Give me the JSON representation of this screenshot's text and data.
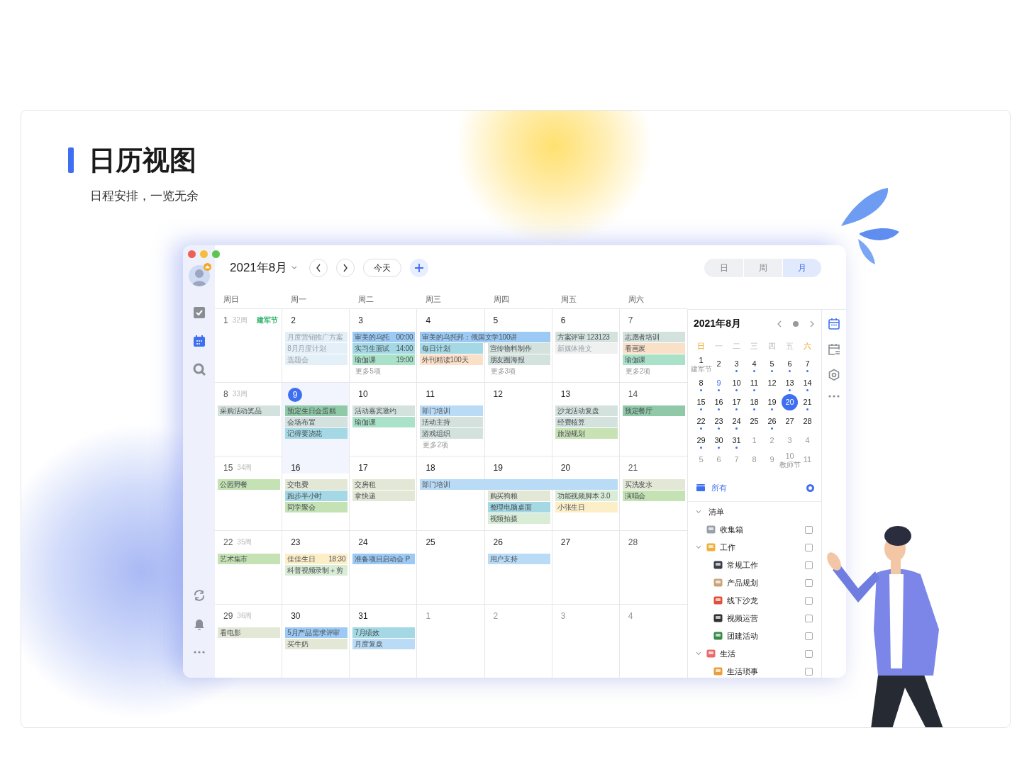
{
  "page": {
    "title": "日历视图",
    "subtitle": "日程安排，一览无余"
  },
  "nav": [
    {
      "kind": "tasks",
      "selected": false
    },
    {
      "kind": "calendar",
      "selected": true
    },
    {
      "kind": "search",
      "selected": false
    }
  ],
  "header": {
    "month": "2021年8月",
    "today_button": "今天",
    "views": [
      {
        "label": "日",
        "selected": false
      },
      {
        "label": "周",
        "selected": false
      },
      {
        "label": "月",
        "selected": true
      }
    ]
  },
  "weekdays": [
    "周日",
    "周一",
    "周二",
    "周三",
    "周四",
    "周五",
    "周六"
  ],
  "weeks": [
    {
      "days": [
        {
          "day": "1",
          "week": "32周",
          "holiday": "建军节",
          "today": false,
          "outside": false
        },
        {
          "day": "2",
          "today": false,
          "outside": false,
          "events": [
            {
              "title": "月度营销推广方案",
              "color": "#e4f0f8",
              "done": true
            },
            {
              "title": "8月月度计划",
              "color": "#e4f0f8",
              "done": true
            },
            {
              "title": "选题会",
              "color": "#e4f0f8",
              "done": true
            }
          ]
        },
        {
          "day": "3",
          "today": false,
          "outside": false,
          "events": [
            {
              "title": "审美的乌托",
              "time": "00:00",
              "color": "#9ccaf4",
              "done": false
            },
            {
              "title": "实习生面试",
              "time": "14:00",
              "color": "#a3d8e4",
              "done": false
            },
            {
              "title": "瑜伽课",
              "time": "19:00",
              "color": "#a9e2c8",
              "done": false
            }
          ],
          "more": "更多5项"
        },
        {
          "day": "4",
          "today": false,
          "outside": false,
          "events": [
            {
              "title": "审美的乌托邦：俄国文学100讲",
              "color": "#9ccaf4",
              "kind": "multi_day",
              "done": false
            },
            {
              "title": "每日计划",
              "color": "#a3d8e4",
              "done": false
            },
            {
              "title": "外刊精读100天",
              "color": "#fbe0c8",
              "done": false
            }
          ]
        },
        {
          "day": "5",
          "today": false,
          "outside": false,
          "events": [
            {
              "kind": "continued"
            },
            {
              "title": "宣传物料制作",
              "color": "#d4e2de",
              "done": false
            },
            {
              "title": "朋友圈海报",
              "color": "#d4e2de",
              "done": false
            }
          ],
          "more": "更多3项"
        },
        {
          "day": "6",
          "today": false,
          "outside": false,
          "events": [
            {
              "title": "方案评审 123123",
              "color": "#d4e2de",
              "done": false
            },
            {
              "title": "新媒体推文",
              "color": "#eef1f0",
              "done": true
            }
          ]
        },
        {
          "day": "7",
          "today": false,
          "outside": false,
          "events": [
            {
              "title": "志愿者培训",
              "color": "#d4e2de",
              "done": false
            },
            {
              "title": "看画展",
              "color": "#fbe0c8",
              "done": false
            },
            {
              "title": "瑜伽课",
              "color": "#a9e2c8",
              "done": false
            }
          ],
          "more": "更多2项"
        }
      ]
    },
    {
      "days": [
        {
          "day": "8",
          "week": "33周",
          "today": false,
          "outside": false,
          "events": [
            {
              "title": "采购活动奖品",
              "color": "#d4e2de",
              "done": false
            }
          ]
        },
        {
          "day": "9",
          "today": true,
          "outside": false,
          "events": [
            {
              "title": "预定生日会蛋糕",
              "color": "#8fc9a7",
              "done": false
            },
            {
              "title": "会场布置",
              "color": "#d4e2de",
              "done": false
            },
            {
              "title": "记得要浇花",
              "color": "#a3d8e4",
              "done": false
            }
          ]
        },
        {
          "day": "10",
          "today": false,
          "outside": false,
          "events": [
            {
              "title": "活动嘉宾邀约",
              "color": "#d4e2de",
              "done": false
            },
            {
              "title": "瑜伽课",
              "color": "#a9e2c8",
              "done": false
            }
          ]
        },
        {
          "day": "11",
          "today": false,
          "outside": false,
          "events": [
            {
              "title": "部门培训",
              "color": "#b9dbf6",
              "done": false
            },
            {
              "title": "活动主持",
              "color": "#d4e2de",
              "done": false
            },
            {
              "title": "游戏组织",
              "color": "#d4e2de",
              "done": false
            }
          ],
          "more": "更多2项"
        },
        {
          "day": "12",
          "today": false,
          "outside": false
        },
        {
          "day": "13",
          "today": false,
          "outside": false,
          "events": [
            {
              "title": "沙龙活动复盘",
              "color": "#d4e2de",
              "done": false
            },
            {
              "title": "经费核算",
              "color": "#d4e2de",
              "done": false
            },
            {
              "title": "旅游规划",
              "color": "#c9e2b4",
              "done": false
            }
          ]
        },
        {
          "day": "14",
          "today": false,
          "outside": false,
          "events": [
            {
              "title": "预定餐厅",
              "color": "#8fc9a7",
              "done": false
            }
          ]
        }
      ]
    },
    {
      "days": [
        {
          "day": "15",
          "week": "34周",
          "today": false,
          "outside": false,
          "events": [
            {
              "title": "公园野餐",
              "color": "#c5e2b4",
              "done": false
            }
          ]
        },
        {
          "day": "16",
          "today": false,
          "outside": false,
          "events": [
            {
              "title": "交电费",
              "color": "#e3e8d6",
              "done": false
            },
            {
              "title": "跑步半小时",
              "color": "#a3d8e4",
              "done": false
            },
            {
              "title": "同学聚会",
              "color": "#c5e2b4",
              "done": false
            }
          ]
        },
        {
          "day": "17",
          "today": false,
          "outside": false,
          "events": [
            {
              "title": "交房租",
              "color": "#e3e8d6",
              "done": false
            },
            {
              "title": "拿快递",
              "color": "#e3e8d6",
              "done": false
            }
          ]
        },
        {
          "day": "18",
          "today": false,
          "outside": false,
          "events": [
            {
              "title": "部门培训",
              "color": "#b9dbf6",
              "kind": "multi_day",
              "done": false
            }
          ]
        },
        {
          "day": "19",
          "today": false,
          "outside": false,
          "events": [
            {
              "kind": "continued"
            },
            {
              "title": "购买狗粮",
              "color": "#e3e8d6",
              "done": false
            },
            {
              "title": "整理电脑桌面",
              "color": "#a3d8e4",
              "done": false
            },
            {
              "title": "视频拍摄",
              "color": "#d9ecd6",
              "done": false
            }
          ]
        },
        {
          "day": "20",
          "today": false,
          "outside": false,
          "events": [
            {
              "kind": "continued"
            },
            {
              "title": "功能视频脚本 3.0",
              "color": "#d9ecd6",
              "done": false
            },
            {
              "title": "小张生日",
              "color": "#fcefc8",
              "done": false
            }
          ]
        },
        {
          "day": "21",
          "today": false,
          "outside": false,
          "events": [
            {
              "title": "买洗发水",
              "color": "#e3e8d6",
              "done": false
            },
            {
              "title": "演唱会",
              "color": "#c5e2b4",
              "done": false
            }
          ]
        }
      ]
    },
    {
      "days": [
        {
          "day": "22",
          "week": "35周",
          "today": false,
          "outside": false,
          "events": [
            {
              "title": "艺术集市",
              "color": "#c5e2b4",
              "done": false
            }
          ]
        },
        {
          "day": "23",
          "today": false,
          "outside": false,
          "events": [
            {
              "title": "佳佳生日",
              "time": "18:30",
              "color": "#fcefc8",
              "done": false
            },
            {
              "title": "科普视频录制＋剪",
              "color": "#d9ecd6",
              "done": false
            }
          ]
        },
        {
          "day": "24",
          "today": false,
          "outside": false,
          "events": [
            {
              "title": "准备项目启动会 P",
              "color": "#9ccaf4",
              "done": false
            }
          ]
        },
        {
          "day": "25",
          "today": false,
          "outside": false
        },
        {
          "day": "26",
          "today": false,
          "outside": false,
          "events": [
            {
              "title": "用户支持",
              "color": "#b9dbf6",
              "done": false
            }
          ]
        },
        {
          "day": "27",
          "today": false,
          "outside": false
        },
        {
          "day": "28",
          "today": false,
          "outside": false
        }
      ]
    },
    {
      "days": [
        {
          "day": "29",
          "week": "36周",
          "today": false,
          "outside": false,
          "events": [
            {
              "title": "看电影",
              "color": "#e3e8d6",
              "done": false
            }
          ]
        },
        {
          "day": "30",
          "today": false,
          "outside": false,
          "events": [
            {
              "title": "5月产品需求评审",
              "color": "#9ccaf4",
              "done": false
            },
            {
              "title": "买牛奶",
              "color": "#e3e8d6",
              "done": false
            }
          ]
        },
        {
          "day": "31",
          "today": false,
          "outside": false,
          "events": [
            {
              "title": "7月绩效",
              "color": "#a3d8e4",
              "done": false
            },
            {
              "title": "月度复盘",
              "color": "#b9dbf6",
              "done": false
            }
          ]
        },
        {
          "day": "1",
          "today": false,
          "outside": true
        },
        {
          "day": "2",
          "today": false,
          "outside": true
        },
        {
          "day": "3",
          "today": false,
          "outside": true
        },
        {
          "day": "4",
          "today": false,
          "outside": true
        }
      ]
    }
  ],
  "mini_calendar": {
    "title": "2021年8月",
    "weekdays": [
      "日",
      "一",
      "二",
      "三",
      "四",
      "五",
      "六"
    ],
    "days": [
      [
        {
          "day": "1",
          "note": "建军节",
          "dot": false,
          "outside": false,
          "today": false,
          "selected": false
        },
        {
          "day": "2",
          "dot": false,
          "outside": false,
          "today": false,
          "selected": false
        },
        {
          "day": "3",
          "dot": true,
          "outside": false,
          "today": false,
          "selected": false
        },
        {
          "day": "4",
          "dot": true,
          "outside": false,
          "today": false,
          "selected": false
        },
        {
          "day": "5",
          "dot": true,
          "outside": false,
          "today": false,
          "selected": false
        },
        {
          "day": "6",
          "dot": true,
          "outside": false,
          "today": false,
          "selected": false
        },
        {
          "day": "7",
          "dot": true,
          "outside": false,
          "today": false,
          "selected": false
        }
      ],
      [
        {
          "day": "8",
          "dot": true,
          "outside": false,
          "today": false,
          "selected": false
        },
        {
          "day": "9",
          "dot": true,
          "outside": false,
          "today": true,
          "selected": false
        },
        {
          "day": "10",
          "dot": true,
          "outside": false,
          "today": false,
          "selected": false
        },
        {
          "day": "11",
          "dot": true,
          "outside": false,
          "today": false,
          "selected": false
        },
        {
          "day": "12",
          "dot": false,
          "outside": false,
          "today": false,
          "selected": false
        },
        {
          "day": "13",
          "dot": true,
          "outside": false,
          "today": false,
          "selected": false
        },
        {
          "day": "14",
          "dot": true,
          "outside": false,
          "today": false,
          "selected": false
        }
      ],
      [
        {
          "day": "15",
          "dot": true,
          "outside": false,
          "today": false,
          "selected": false
        },
        {
          "day": "16",
          "dot": true,
          "outside": false,
          "today": false,
          "selected": false
        },
        {
          "day": "17",
          "dot": true,
          "outside": false,
          "today": false,
          "selected": false
        },
        {
          "day": "18",
          "dot": true,
          "outside": false,
          "today": false,
          "selected": false
        },
        {
          "day": "19",
          "dot": true,
          "outside": false,
          "today": false,
          "selected": false
        },
        {
          "day": "20",
          "dot": false,
          "outside": false,
          "today": false,
          "selected": true
        },
        {
          "day": "21",
          "dot": true,
          "outside": false,
          "today": false,
          "selected": false
        }
      ],
      [
        {
          "day": "22",
          "dot": true,
          "outside": false,
          "today": false,
          "selected": false
        },
        {
          "day": "23",
          "dot": true,
          "outside": false,
          "today": false,
          "selected": false
        },
        {
          "day": "24",
          "dot": true,
          "outside": false,
          "today": false,
          "selected": false
        },
        {
          "day": "25",
          "dot": false,
          "outside": false,
          "today": false,
          "selected": false
        },
        {
          "day": "26",
          "dot": true,
          "outside": false,
          "today": false,
          "selected": false
        },
        {
          "day": "27",
          "dot": false,
          "outside": false,
          "today": false,
          "selected": false
        },
        {
          "day": "28",
          "dot": false,
          "outside": false,
          "today": false,
          "selected": false
        }
      ],
      [
        {
          "day": "29",
          "dot": true,
          "outside": false,
          "today": false,
          "selected": false
        },
        {
          "day": "30",
          "dot": true,
          "outside": false,
          "today": false,
          "selected": false
        },
        {
          "day": "31",
          "dot": true,
          "outside": false,
          "today": false,
          "selected": false
        },
        {
          "day": "1",
          "dot": false,
          "outside": true,
          "today": false,
          "selected": false
        },
        {
          "day": "2",
          "dot": false,
          "outside": true,
          "today": false,
          "selected": false
        },
        {
          "day": "3",
          "dot": false,
          "outside": true,
          "today": false,
          "selected": false
        },
        {
          "day": "4",
          "dot": false,
          "outside": true,
          "today": false,
          "selected": false
        }
      ],
      [
        {
          "day": "5",
          "dot": false,
          "outside": true,
          "today": false,
          "selected": false
        },
        {
          "day": "6",
          "dot": false,
          "outside": true,
          "today": false,
          "selected": false
        },
        {
          "day": "7",
          "dot": false,
          "outside": true,
          "today": false,
          "selected": false
        },
        {
          "day": "8",
          "dot": false,
          "outside": true,
          "today": false,
          "selected": false
        },
        {
          "day": "9",
          "dot": false,
          "outside": true,
          "today": false,
          "selected": false
        },
        {
          "day": "10",
          "note": "教师节",
          "dot": false,
          "outside": true,
          "today": false,
          "selected": false
        },
        {
          "day": "11",
          "dot": false,
          "outside": true,
          "today": false,
          "selected": false
        }
      ]
    ]
  },
  "filter": {
    "label": "所有",
    "selected": true
  },
  "lists": [
    {
      "label": "清单",
      "expanded": true,
      "children": [
        {
          "label": "收集箱",
          "checked": false
        },
        {
          "label": "工作",
          "expanded": true,
          "checked": false,
          "children": [
            {
              "label": "常规工作",
              "checked": false
            },
            {
              "label": "产品规划",
              "checked": false
            },
            {
              "label": "线下沙龙",
              "checked": false
            },
            {
              "label": "视频运营",
              "checked": false
            },
            {
              "label": "团建活动",
              "checked": false
            }
          ]
        },
        {
          "label": "生活",
          "expanded": true,
          "checked": false,
          "children": [
            {
              "label": "生活琐事",
              "checked": false
            }
          ]
        }
      ]
    }
  ],
  "tools": [
    {
      "kind": "calendar",
      "selected": true
    },
    {
      "kind": "agenda",
      "selected": false
    },
    {
      "kind": "settings",
      "selected": false
    }
  ]
}
